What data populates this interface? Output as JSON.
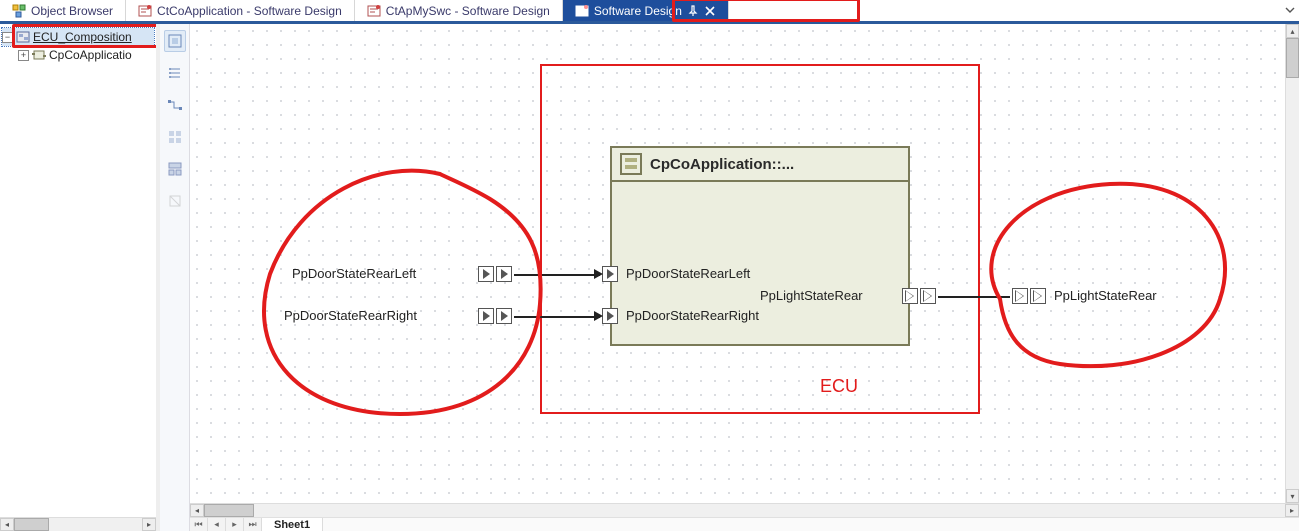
{
  "tabs": {
    "object_browser": "Object Browser",
    "ctco": "CtCoApplication - Software Design",
    "ctap": "CtApMySwc - Software Design",
    "swdesign": "Software Design"
  },
  "tree": {
    "root": "ECU_Composition",
    "child": "CpCoApplicatio"
  },
  "sheet": {
    "name": "Sheet1"
  },
  "diagram": {
    "ecu_label": "ECU",
    "component_title": "CpCoApplication::...",
    "ports": {
      "ext_in1": "PpDoorStateRearLeft",
      "ext_in2": "PpDoorStateRearRight",
      "comp_in1": "PpDoorStateRearLeft",
      "comp_in2": "PpDoorStateRearRight",
      "comp_out": "PpLightStateRear",
      "ext_out": "PpLightStateRear"
    }
  }
}
